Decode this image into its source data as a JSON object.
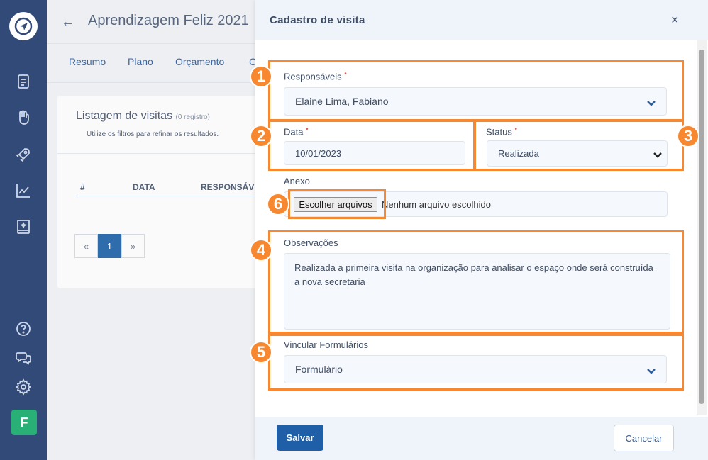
{
  "sidebar": {
    "icons": [
      "document-icon",
      "hand-heart-icon",
      "rocket-icon",
      "chart-icon",
      "book-icon",
      "help-icon",
      "chat-icon",
      "gear-icon"
    ],
    "avatar_letter": "F"
  },
  "page": {
    "title": "Aprendizagem Feliz 2021",
    "tabs": [
      "Resumo",
      "Plano",
      "Orçamento",
      "C"
    ],
    "list_title": "Listagem de visitas",
    "list_count": "(0 registro)",
    "list_subtitle": "Utilize os filtros para refinar os resultados.",
    "columns": [
      "#",
      "DATA",
      "RESPONSÁVE"
    ],
    "pager": [
      "«",
      "1",
      "»"
    ]
  },
  "modal": {
    "title": "Cadastro de visita",
    "close_symbol": "×",
    "responsaveis_label": "Responsáveis",
    "responsaveis_value": "Elaine Lima, Fabiano",
    "data_label": "Data",
    "data_value": "10/01/2023",
    "status_label": "Status",
    "status_value": "Realizada",
    "anexo_label": "Anexo",
    "file_button": "Escolher arquivos",
    "file_status": "Nenhum arquivo escolhido",
    "obs_label": "Observações",
    "obs_value": "Realizada a primeira visita na organização para analisar o espaço onde será construída a nova secretaria",
    "vincular_label": "Vincular Formulários",
    "vincular_placeholder": "Formulário",
    "save": "Salvar",
    "cancel": "Cancelar",
    "required_marker": "•"
  },
  "annotations": [
    "1",
    "2",
    "3",
    "4",
    "5",
    "6"
  ],
  "colors": {
    "accent": "#f7882f",
    "sidebar": "#324a78",
    "primary": "#1e5fa8"
  }
}
